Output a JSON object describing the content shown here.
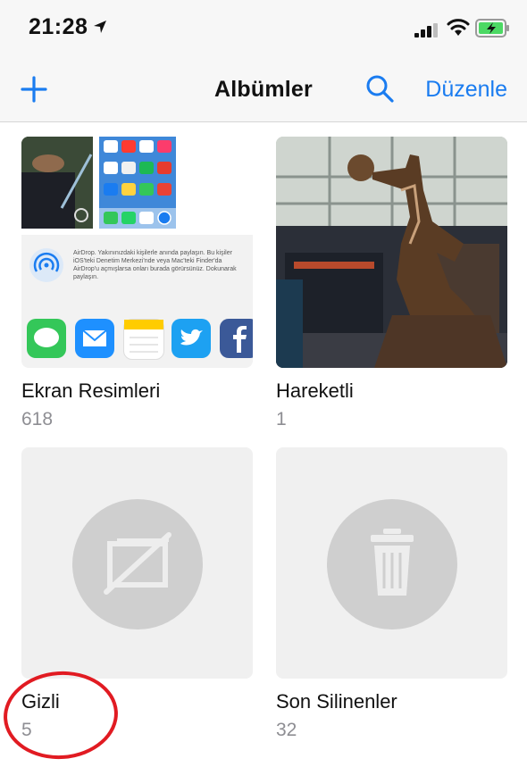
{
  "status_bar": {
    "time": "21:28"
  },
  "nav": {
    "title": "Albümler",
    "edit_label": "Düzenle"
  },
  "albums": [
    {
      "name": "Ekran Resimleri",
      "count": "618"
    },
    {
      "name": "Hareketli",
      "count": "1"
    },
    {
      "name": "Gizli",
      "count": "5"
    },
    {
      "name": "Son Silinenler",
      "count": "32"
    }
  ],
  "screenshot_preview": {
    "airdrop_text": "AirDrop. Yakınınızdaki kişilerle anında paylaşın. Bu kişiler iOS'teki Denetim Merkezi'nde veya Mac'teki Finder'da AirDrop'u açmışlarsa onları burada görürsünüz. Dokunarak paylaşın.",
    "share_apps": [
      "messages-app-icon",
      "mail-app-icon",
      "notes-app-icon",
      "twitter-app-icon",
      "facebook-app-icon"
    ]
  },
  "colors": {
    "accent": "#1a7cf0",
    "annotation": "#e11b22",
    "battery": "#4cd964"
  }
}
